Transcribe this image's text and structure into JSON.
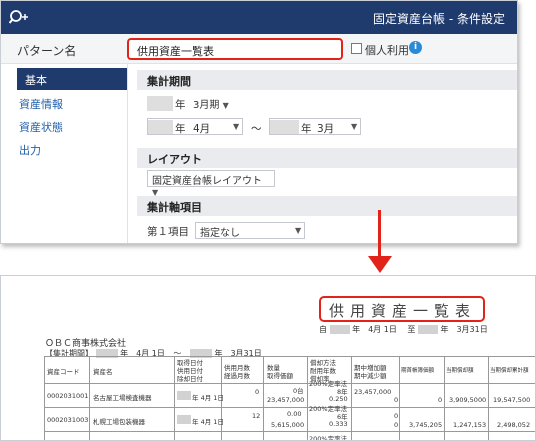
{
  "dialog": {
    "title": "固定資産台帳 - 条件設定",
    "name_label": "パターン名",
    "name_value": "供用資産一覧表",
    "personal_label": "個人利用",
    "info_icon": "i"
  },
  "sidebar": {
    "items": [
      {
        "label": "基本"
      },
      {
        "label": "資産情報"
      },
      {
        "label": "資産状態"
      },
      {
        "label": "出力"
      }
    ]
  },
  "main": {
    "period_heading": "集計期間",
    "period_year_suffix": "年",
    "period_value": "3月期",
    "start_year_suffix": "年",
    "start_month": "4月",
    "range_sep": "～",
    "end_year_suffix": "年",
    "end_month": "3月",
    "layout_heading": "レイアウト",
    "layout_value": "固定資産台帳レイアウト",
    "axis_heading": "集計軸項目",
    "axis1_label": "第１項目",
    "axis1_value": "指定なし"
  },
  "report": {
    "title": "供用資産一覧表",
    "period_from_prefix": "自",
    "period_from": "年　4月 1日",
    "period_to_prefix": "至",
    "period_to": "年　3月31日",
    "company": "ＯＢＣ商事株式会社",
    "period_label": "【集計期間】",
    "period_start": "年　4月 1日",
    "period_sep": "～",
    "period_end": "年　3月31日",
    "headers": {
      "code": "資産コード",
      "name": "資産名",
      "dates": [
        "取得日付",
        "供用日付",
        "除却日付"
      ],
      "months": [
        "供用月数",
        "経過月数"
      ],
      "qty": [
        "数量",
        "取得価額"
      ],
      "method": [
        "償却方法",
        "耐用年数",
        "償却率"
      ],
      "start_book": [
        "期中増加額",
        "期中減少額"
      ],
      "col8": "期首帳簿価額",
      "col9": "当期償却額",
      "col10": "当期償却累計額",
      "col11": "期末帳簿価額"
    },
    "rows": [
      {
        "code": "0002031001",
        "name": "名古屋工場検査機器",
        "date": "年 4月 1日",
        "months": "0",
        "qty": "0台",
        "cost": "23,457,000",
        "method": "200%定率法",
        "life": "8年",
        "rate": "0.250",
        "increase": "23,457,000",
        "decrease": "0",
        "c8": "0",
        "c9": "0",
        "c10": "3,909,500",
        "c11": "19,547,500"
      },
      {
        "code": "0002031003",
        "name": "札幌工場包装機器",
        "date": "年 4月 1日",
        "months": "12",
        "qty": "0.00",
        "cost": "5,615,000",
        "method": "200%定率法",
        "life": "6年",
        "rate": "0.333",
        "increase": "0",
        "decrease": "0",
        "c8": "3,745,205",
        "c9": "1,247,153",
        "c10": "2,498,052",
        "c11": ""
      }
    ],
    "row3_method": "200%定率法"
  }
}
